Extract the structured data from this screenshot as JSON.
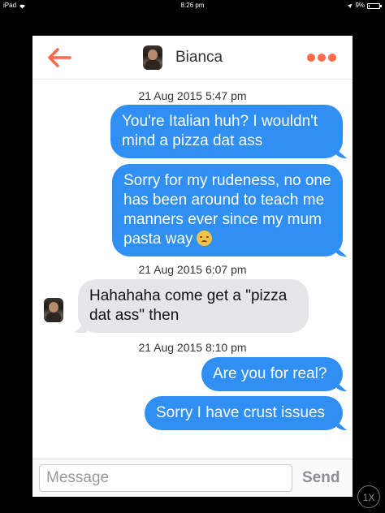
{
  "status_bar": {
    "device": "iPad",
    "time": "8:26 pm",
    "battery": "9%"
  },
  "header": {
    "contact_name": "Bianca"
  },
  "conversation": [
    {
      "type": "timestamp",
      "text": "21 Aug 2015 5:47 pm"
    },
    {
      "type": "outgoing",
      "text": "You're Italian huh? I wouldn't mind a pizza dat ass"
    },
    {
      "type": "outgoing",
      "text": "Sorry for my rudeness, no one has been around to teach me manners ever since my mum pasta way",
      "emoji": "sad-face"
    },
    {
      "type": "timestamp",
      "text": "21 Aug 2015 6:07 pm"
    },
    {
      "type": "incoming",
      "text": "Hahahaha come get a \"pizza dat ass\" then"
    },
    {
      "type": "timestamp",
      "text": "21 Aug 2015 8:10 pm"
    },
    {
      "type": "outgoing",
      "text": "Are you for real?"
    },
    {
      "type": "outgoing",
      "text": "Sorry I have crust issues"
    }
  ],
  "composer": {
    "placeholder": "Message",
    "send_label": "Send"
  },
  "zoom_label": "1X",
  "colors": {
    "accent": "#fb6a4a",
    "outgoing_bubble": "#2f8ff2",
    "incoming_bubble": "#e6e6ea"
  }
}
